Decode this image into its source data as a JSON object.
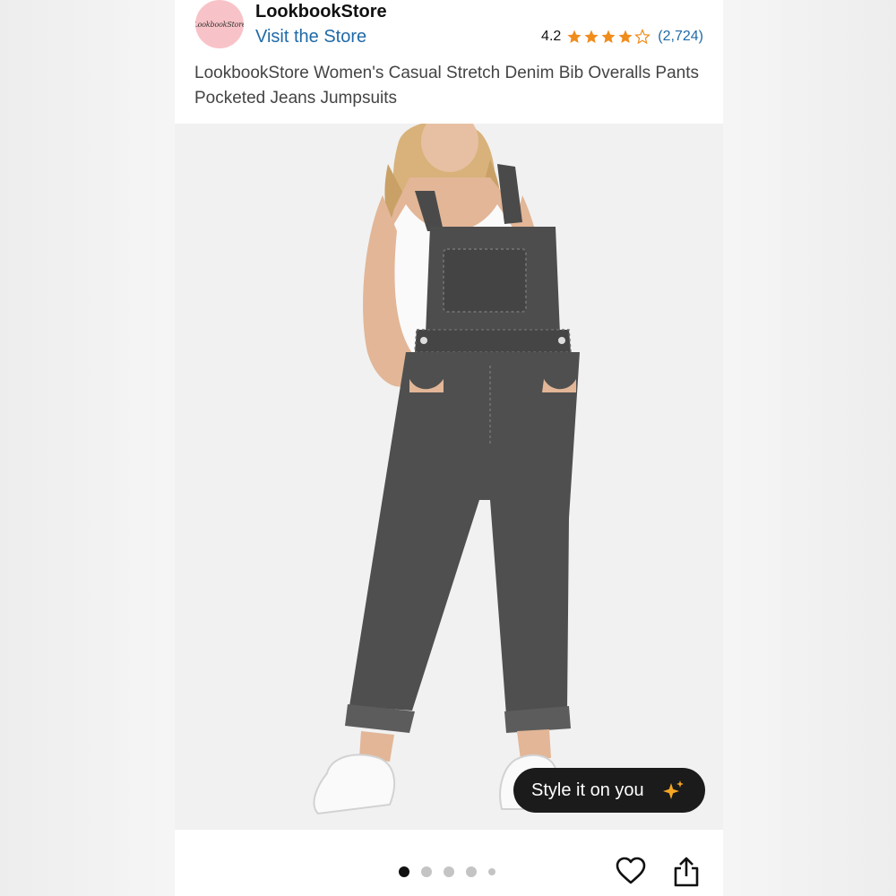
{
  "store": {
    "logo_text": "LookbookStore",
    "name": "LookbookStore",
    "visit_label": "Visit the Store"
  },
  "rating": {
    "value": "4.2",
    "stars_out_of_5": 4.2,
    "count": "(2,724)"
  },
  "product": {
    "title": "LookbookStore Women's Casual Stretch Denim Bib Overalls Pants Pocketed Jeans Jumpsuits"
  },
  "image": {
    "style_button_label": "Style it on you",
    "carousel_total": 5,
    "carousel_active": 1
  },
  "icons": {
    "star": "star-icon",
    "sparkle": "sparkle-icon",
    "heart": "heart-icon",
    "share": "share-icon"
  },
  "colors": {
    "link": "#1f6aa8",
    "star": "#f08c1c",
    "button_bg": "#1b1b1b",
    "logo_bg": "#f8c3c8"
  }
}
